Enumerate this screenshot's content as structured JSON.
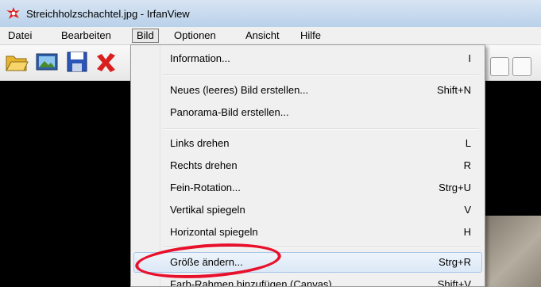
{
  "window": {
    "title": "Streichholzschachtel.jpg - IrfanView"
  },
  "menubar": {
    "items": [
      {
        "label": "Datei"
      },
      {
        "label": "Bearbeiten"
      },
      {
        "label": "Bild"
      },
      {
        "label": "Optionen"
      },
      {
        "label": "Ansicht"
      },
      {
        "label": "Hilfe"
      }
    ],
    "active": "Bild"
  },
  "toolbar": {
    "icons": [
      "open-folder-icon",
      "thumbnails-icon",
      "save-icon",
      "delete-icon"
    ]
  },
  "menu": {
    "items": [
      {
        "label": "Information...",
        "shortcut": "I"
      },
      {
        "label": "Neues (leeres) Bild erstellen...",
        "shortcut": "Shift+N"
      },
      {
        "label": "Panorama-Bild erstellen...",
        "shortcut": ""
      },
      {
        "label": "Links drehen",
        "shortcut": "L"
      },
      {
        "label": "Rechts drehen",
        "shortcut": "R"
      },
      {
        "label": "Fein-Rotation...",
        "shortcut": "Strg+U"
      },
      {
        "label": "Vertikal spiegeln",
        "shortcut": "V"
      },
      {
        "label": "Horizontal spiegeln",
        "shortcut": "H"
      },
      {
        "label": "Größe ändern...",
        "shortcut": "Strg+R"
      },
      {
        "label": "Farb-Rahmen hinzufügen (Canvas)",
        "shortcut": "Shift+V"
      }
    ],
    "highlighted": "Größe ändern..."
  },
  "annotation": {
    "color": "#e8102a",
    "shape": "ellipse"
  }
}
